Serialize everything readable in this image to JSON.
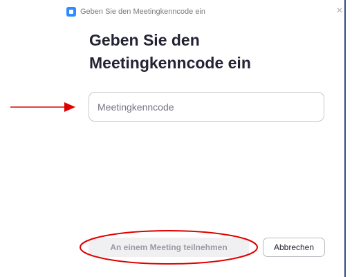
{
  "window": {
    "title": "Geben Sie den Meetingkenncode ein",
    "app_icon": "zoom-app-icon",
    "close_glyph": "×"
  },
  "dialog": {
    "heading_line1": "Geben Sie den",
    "heading_line2": "Meetingkenncode ein",
    "passcode_input": {
      "value": "",
      "placeholder": "Meetingkenncode"
    },
    "join_button_label": "An einem Meeting teilnehmen",
    "cancel_button_label": "Abbrechen"
  },
  "annotations": {
    "arrow_icon": "red-arrow-icon",
    "highlight_shape": "red-ellipse"
  },
  "colors": {
    "accent_blue": "#2d8cff",
    "annotation_red": "#e00000",
    "heading_text": "#232333",
    "disabled_button_bg": "#f0f0f2",
    "disabled_button_text": "#9a9aa5"
  }
}
